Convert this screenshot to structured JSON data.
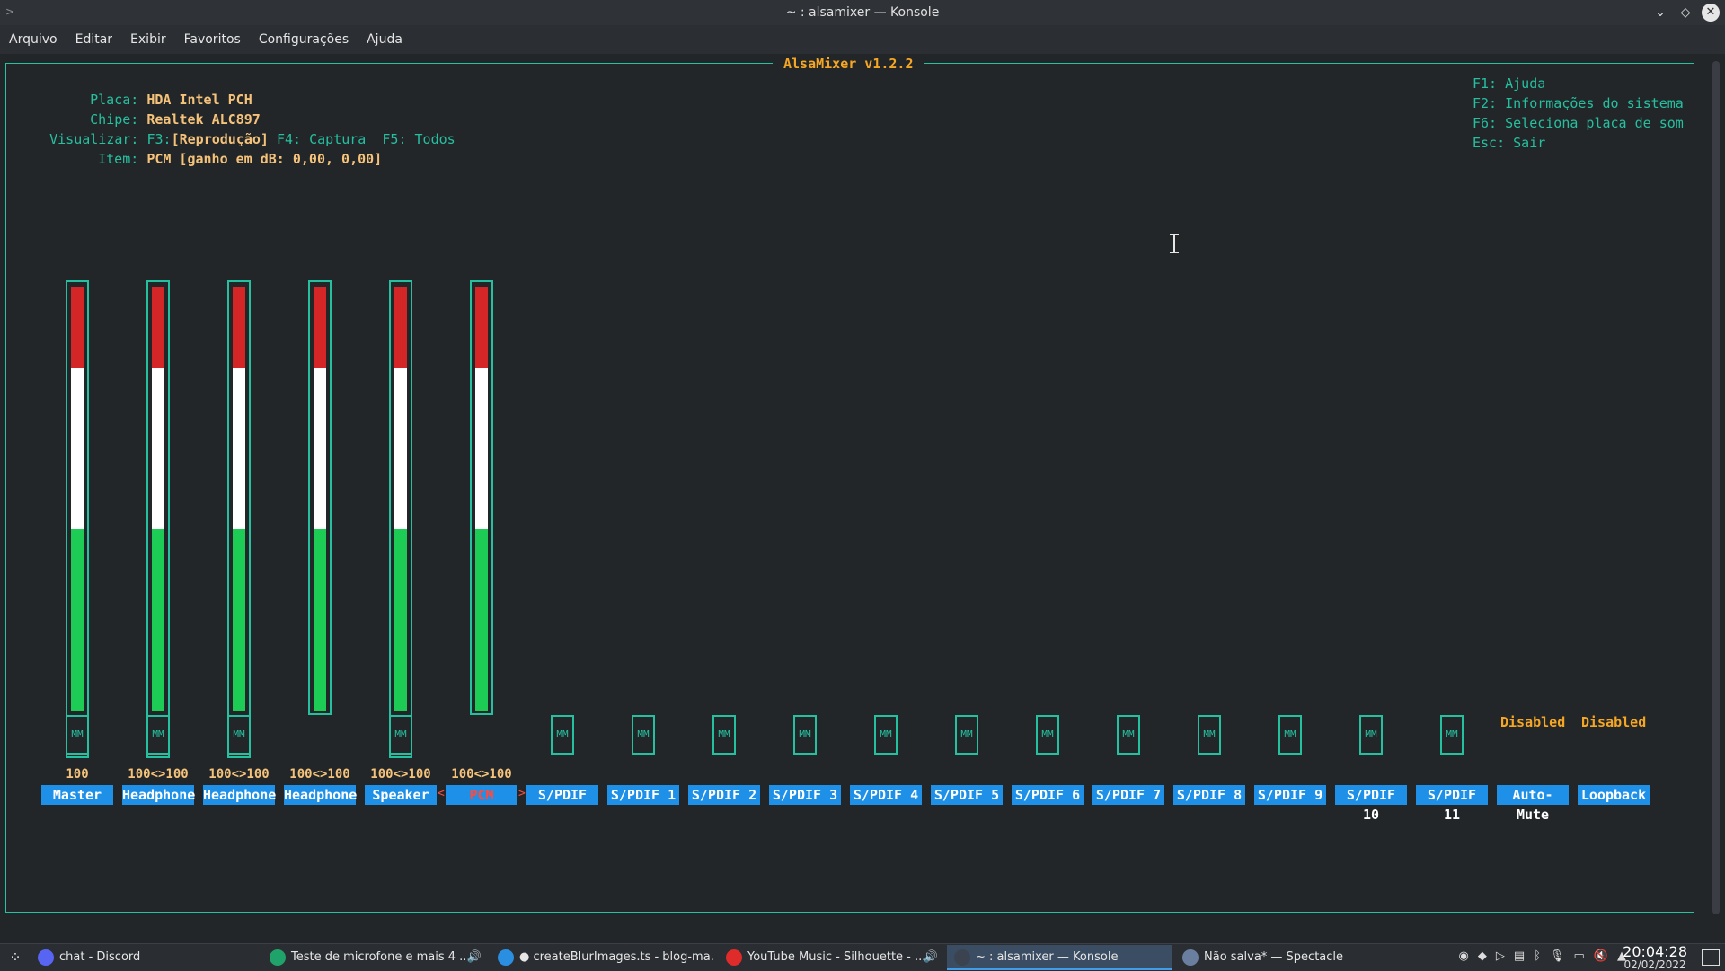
{
  "window": {
    "title": "~ : alsamixer — Konsole"
  },
  "menu": [
    "Arquivo",
    "Editar",
    "Exibir",
    "Favoritos",
    "Configurações",
    "Ajuda"
  ],
  "mixer": {
    "title": "AlsaMixer v1.2.2",
    "card_label": "Placa:",
    "card_value": "HDA Intel PCH",
    "chip_label": "Chipe:",
    "chip_value": "Realtek ALC897",
    "view_label": "Visualizar:",
    "view_f3": "F3:",
    "view_f3_value": "[Reprodução]",
    "view_others": " F4: Captura  F5: Todos",
    "item_label": "Item:",
    "item_value": "PCM [ganho em dB: 0,00, 0,00]",
    "help": [
      "F1: Ajuda",
      "F2: Informações do sistema",
      "F6: Seleciona placa de som",
      "Esc: Sair"
    ],
    "channels": [
      {
        "label": "Master",
        "value": "100",
        "level": 1.0,
        "has_volume": true,
        "mm": true
      },
      {
        "label": "Headphone",
        "value": "100<>100",
        "level": 1.0,
        "has_volume": true,
        "mm": true
      },
      {
        "label": "Headphone",
        "value": "100<>100",
        "level": 1.0,
        "has_volume": true,
        "mm": true
      },
      {
        "label": "Headphone",
        "value": "100<>100",
        "level": 1.0,
        "has_volume": true,
        "mm": false
      },
      {
        "label": "Speaker",
        "value": "100<>100",
        "level": 1.0,
        "has_volume": true,
        "mm": true
      },
      {
        "label": "PCM",
        "value": "100<>100",
        "level": 1.0,
        "has_volume": true,
        "mm": false,
        "selected": true
      },
      {
        "label": "S/PDIF",
        "value": "",
        "has_volume": false,
        "mm": true
      },
      {
        "label": "S/PDIF 1",
        "value": "",
        "has_volume": false,
        "mm": true
      },
      {
        "label": "S/PDIF 2",
        "value": "",
        "has_volume": false,
        "mm": true
      },
      {
        "label": "S/PDIF 3",
        "value": "",
        "has_volume": false,
        "mm": true
      },
      {
        "label": "S/PDIF 4",
        "value": "",
        "has_volume": false,
        "mm": true
      },
      {
        "label": "S/PDIF 5",
        "value": "",
        "has_volume": false,
        "mm": true
      },
      {
        "label": "S/PDIF 6",
        "value": "",
        "has_volume": false,
        "mm": true
      },
      {
        "label": "S/PDIF 7",
        "value": "",
        "has_volume": false,
        "mm": true
      },
      {
        "label": "S/PDIF 8",
        "value": "",
        "has_volume": false,
        "mm": true
      },
      {
        "label": "S/PDIF 9",
        "value": "",
        "has_volume": false,
        "mm": true
      },
      {
        "label": "S/PDIF 10",
        "value": "",
        "has_volume": false,
        "mm": true
      },
      {
        "label": "S/PDIF 11",
        "value": "",
        "has_volume": false,
        "mm": true
      },
      {
        "label": "Auto-Mute",
        "value": "",
        "has_volume": false,
        "mm": false,
        "state": "Disabled"
      },
      {
        "label": "Loopback",
        "value": "",
        "has_volume": false,
        "mm": false,
        "state": "Disabled"
      }
    ],
    "mm_text": "MM"
  },
  "taskbar": {
    "tasks": [
      {
        "label": "chat - Discord",
        "icon": "discord-icon",
        "color": "#5865f2"
      },
      {
        "label": "Teste de microfone e mais 4 ...",
        "icon": "edge-icon",
        "color": "#1fa36b",
        "audio": true
      },
      {
        "label": "● createBlurImages.ts - blog-ma...",
        "icon": "vscode-icon",
        "color": "#2a8fe0"
      },
      {
        "label": "YouTube Music - Silhouette - ...",
        "icon": "youtube-music-icon",
        "color": "#e02b2b",
        "audio": true
      },
      {
        "label": "~ : alsamixer — Konsole",
        "icon": "konsole-icon",
        "color": "#3b4350",
        "active": true
      },
      {
        "label": "Não salva* — Spectacle",
        "icon": "spectacle-icon",
        "color": "#6a7fa0"
      }
    ],
    "time": "20:04:28",
    "date": "02/02/2022"
  },
  "colors": {
    "accent": "#25c0a0",
    "label_bg": "#1e90e8",
    "red": "#d42626",
    "white": "#ffffff",
    "green": "#1ccc55",
    "orange": "#f5a623"
  }
}
